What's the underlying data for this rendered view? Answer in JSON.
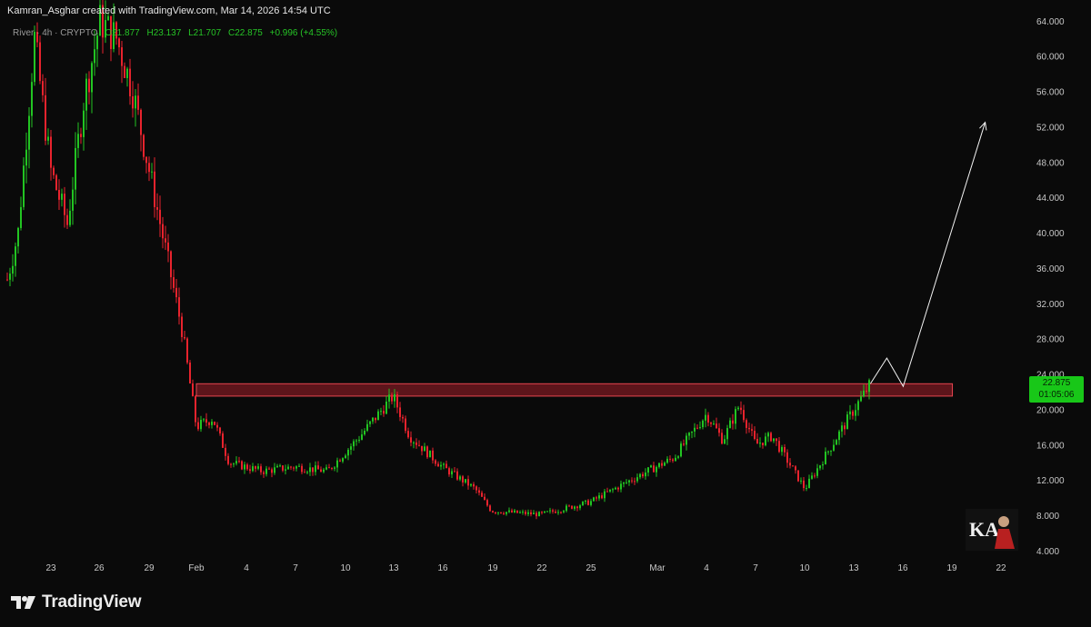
{
  "header": {
    "attribution": "Kamran_Asghar created with TradingView.com, Mar 14, 2026 14:54 UTC"
  },
  "legend": {
    "symbol": "River · 4h · CRYPTO",
    "open": "O21.877",
    "high": "H23.137",
    "low": "L21.707",
    "close": "C22.875",
    "change": "+0.996 (+4.55%)"
  },
  "price_tag": {
    "price": "22.875",
    "countdown": "01:05:06"
  },
  "brand": {
    "name": "TradingView"
  },
  "badge": {
    "initials": "KA"
  },
  "colors": {
    "up": "#22c422",
    "down": "#e8232d",
    "zone_fill": "#7a1a22",
    "zone_border": "#e84550",
    "background": "#0a0a0a",
    "text": "#c8c8c8"
  },
  "chart_data": {
    "type": "candlestick",
    "title": "",
    "xlabel": "",
    "ylabel": "",
    "y_ticks": [
      "4.000",
      "8.000",
      "12.000",
      "16.000",
      "20.000",
      "24.000",
      "28.000",
      "32.000",
      "36.000",
      "40.000",
      "44.000",
      "48.000",
      "52.000",
      "56.000",
      "60.000",
      "64.000"
    ],
    "x_ticks": [
      "23",
      "26",
      "29",
      "Feb",
      "4",
      "7",
      "10",
      "13",
      "16",
      "19",
      "22",
      "25",
      "Mar",
      "4",
      "7",
      "10",
      "13",
      "16",
      "19",
      "22"
    ],
    "ylim": [
      4,
      64
    ],
    "grid": false,
    "price_path": [
      {
        "date": "Jan 20",
        "close": 32
      },
      {
        "date": "Jan 21",
        "close": 40
      },
      {
        "date": "Jan 22",
        "close": 62
      },
      {
        "date": "Jan 23",
        "close": 47
      },
      {
        "date": "Jan 24",
        "close": 41
      },
      {
        "date": "Jan 25",
        "close": 55
      },
      {
        "date": "Jan 26",
        "close": 64
      },
      {
        "date": "Jan 27",
        "close": 62
      },
      {
        "date": "Jan 28",
        "close": 56
      },
      {
        "date": "Jan 29",
        "close": 47
      },
      {
        "date": "Jan 30",
        "close": 38
      },
      {
        "date": "Jan 31",
        "close": 29
      },
      {
        "date": "Feb 1",
        "close": 18
      },
      {
        "date": "Feb 2",
        "close": 19
      },
      {
        "date": "Feb 3",
        "close": 14
      },
      {
        "date": "Feb 5",
        "close": 13
      },
      {
        "date": "Feb 7",
        "close": 13.5
      },
      {
        "date": "Feb 9",
        "close": 13
      },
      {
        "date": "Feb 11",
        "close": 17
      },
      {
        "date": "Feb 13",
        "close": 21.5
      },
      {
        "date": "Feb 14",
        "close": 17
      },
      {
        "date": "Feb 16",
        "close": 13.5
      },
      {
        "date": "Feb 18",
        "close": 11
      },
      {
        "date": "Feb 19",
        "close": 8.5
      },
      {
        "date": "Feb 22",
        "close": 8.1
      },
      {
        "date": "Feb 25",
        "close": 9.5
      },
      {
        "date": "Feb 28",
        "close": 12.5
      },
      {
        "date": "Mar 2",
        "close": 14.5
      },
      {
        "date": "Mar 4",
        "close": 19.5
      },
      {
        "date": "Mar 5",
        "close": 16.5
      },
      {
        "date": "Mar 6",
        "close": 20.5
      },
      {
        "date": "Mar 7",
        "close": 16
      },
      {
        "date": "Mar 8",
        "close": 17
      },
      {
        "date": "Mar 10",
        "close": 11
      },
      {
        "date": "Mar 11",
        "close": 14
      },
      {
        "date": "Mar 12",
        "close": 17
      },
      {
        "date": "Mar 13",
        "close": 20
      },
      {
        "date": "Mar 14",
        "close": 22.875
      }
    ],
    "resistance_zone": {
      "low": 21.5,
      "high": 22.9,
      "from": "Feb 1",
      "to": "Mar 19"
    },
    "projection": [
      {
        "date": "Mar 14",
        "value": 22.9
      },
      {
        "date": "Mar 15",
        "value": 25.8
      },
      {
        "date": "Mar 16",
        "value": 22.6
      },
      {
        "date": "Mar 21",
        "value": 52.5
      }
    ],
    "last": {
      "open": 21.877,
      "high": 23.137,
      "low": 21.707,
      "close": 22.875,
      "change": 0.996,
      "change_pct": 4.55
    }
  }
}
